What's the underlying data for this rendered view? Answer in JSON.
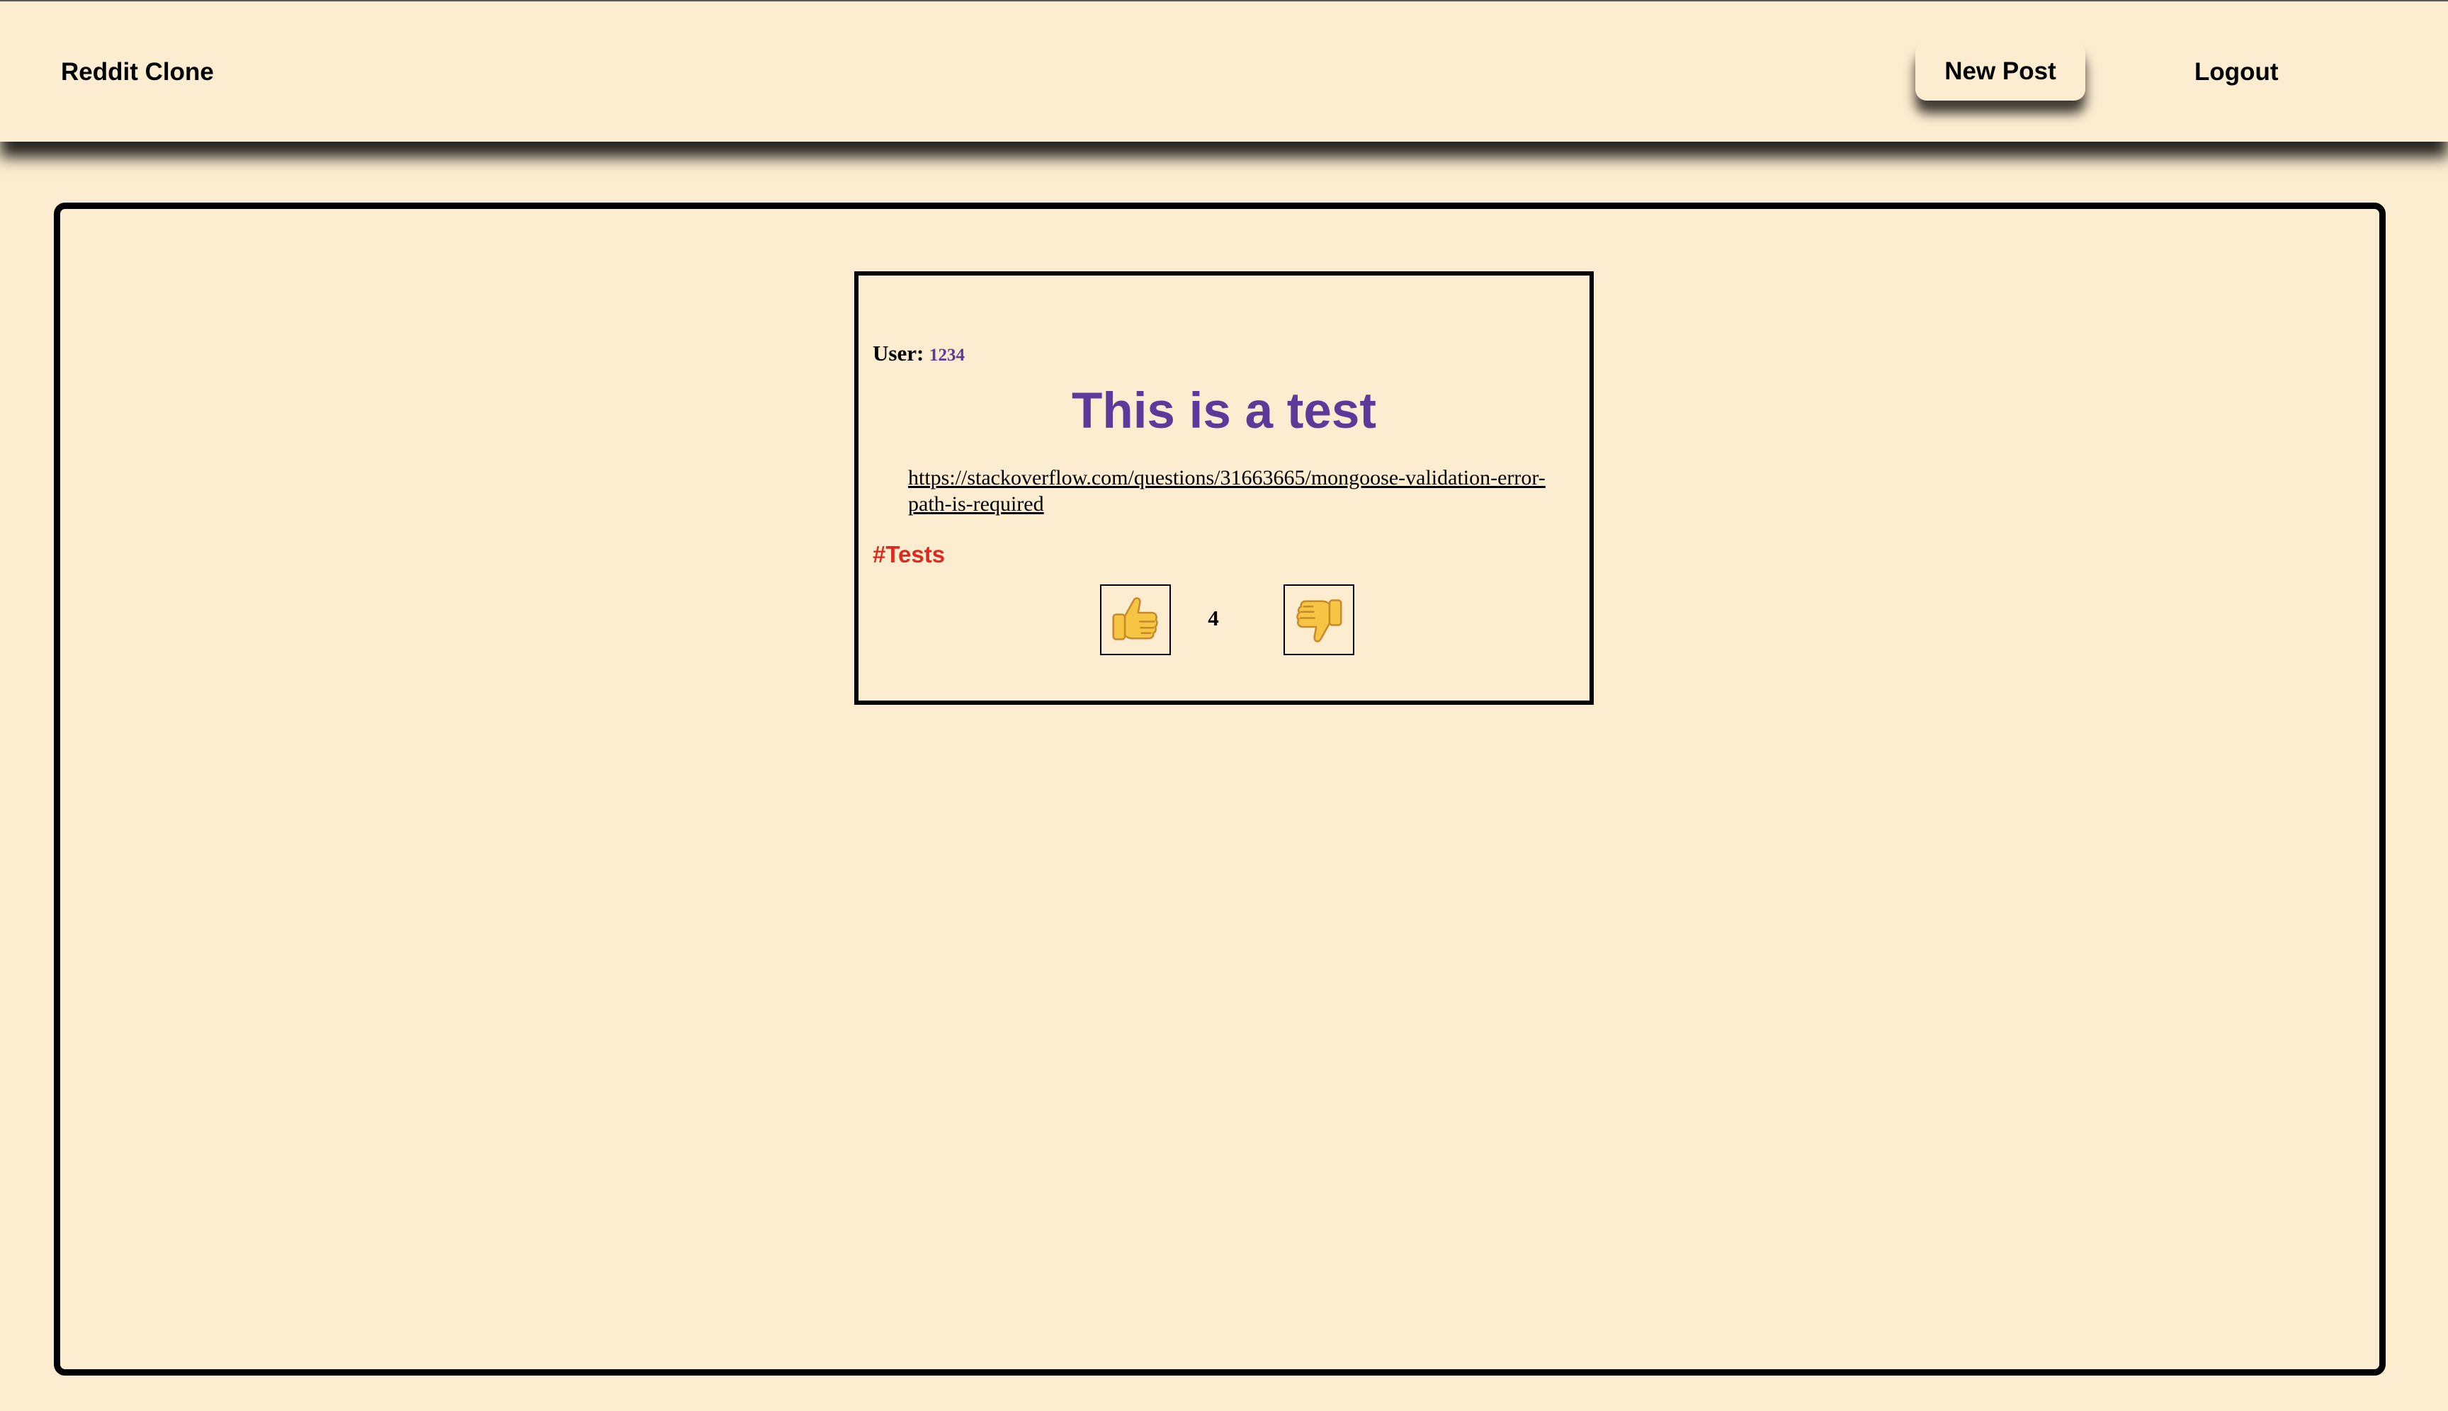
{
  "nav": {
    "brand": "Reddit Clone",
    "new_post_label": "New Post",
    "logout_label": "Logout"
  },
  "post": {
    "user_label": "User:",
    "user_name": "1234",
    "title": "This is a test",
    "url": "https://stackoverflow.com/questions/31663665/mongoose-validation-error-path-is-required",
    "tag": "#Tests",
    "votes": "4",
    "upvote_icon": "thumbs-up-icon",
    "downvote_icon": "thumbs-down-icon"
  },
  "colors": {
    "background": "#fcecd0",
    "title": "#5b3a9a",
    "tag": "#e0291e",
    "border": "#000000"
  }
}
